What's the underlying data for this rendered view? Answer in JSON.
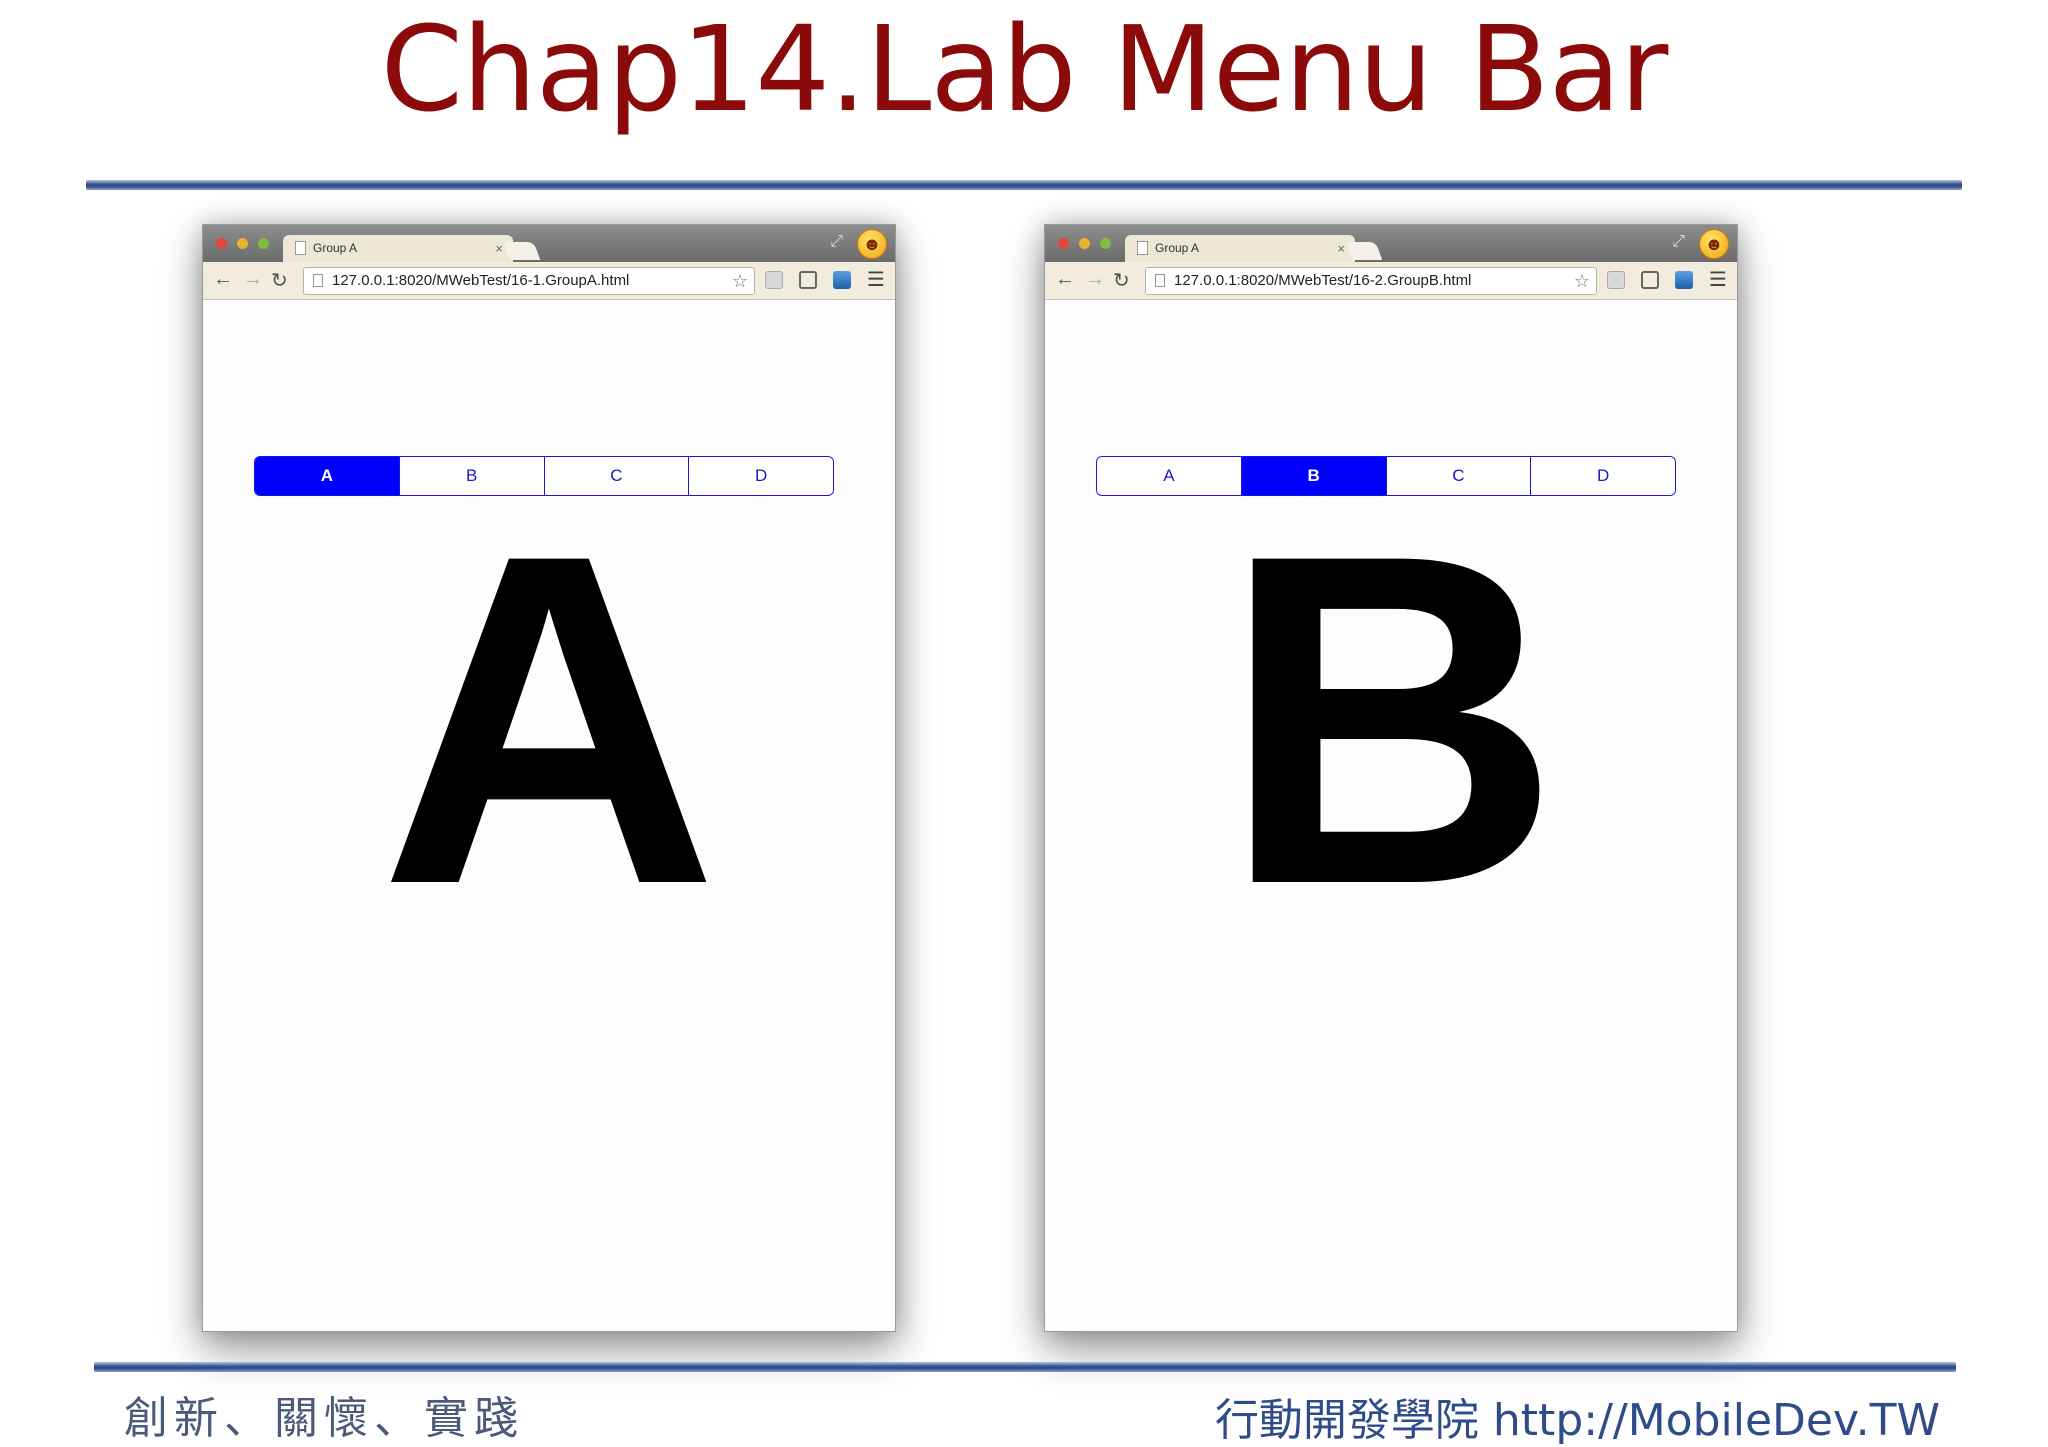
{
  "slide": {
    "title": "Chap14.Lab Menu Bar",
    "footer_left": "創新、關懷、實踐",
    "footer_right": "行動開發學院 http://MobileDev.TW"
  },
  "windows": [
    {
      "tab_title": "Group A",
      "tab_close": "×",
      "url": "127.0.0.1:8020/MWebTest/16-1.GroupA.html",
      "menu": [
        "A",
        "B",
        "C",
        "D"
      ],
      "active": "A",
      "content": "A"
    },
    {
      "tab_title": "Group A",
      "tab_close": "×",
      "url": "127.0.0.1:8020/MWebTest/16-2.GroupB.html",
      "menu": [
        "A",
        "B",
        "C",
        "D"
      ],
      "active": "B",
      "content": "B"
    }
  ],
  "colors": {
    "title": "#8b0a0a",
    "menu_active_bg": "#0000ff",
    "menu_border": "#1a1acc"
  }
}
